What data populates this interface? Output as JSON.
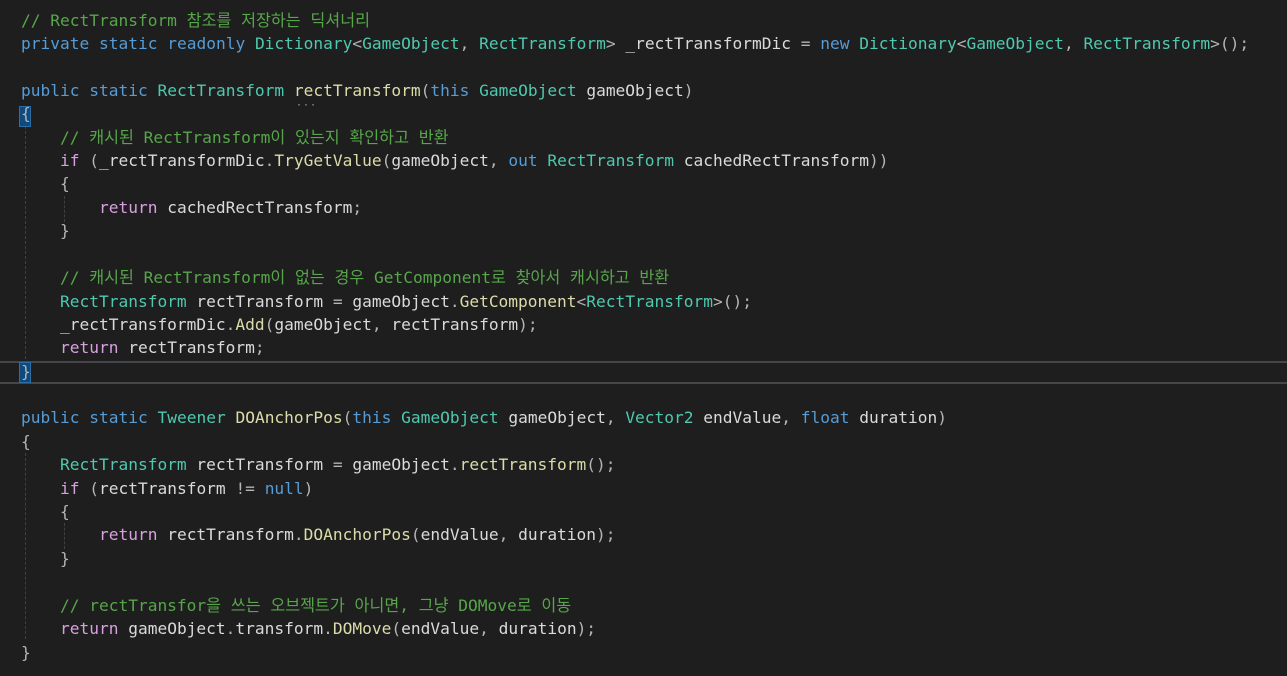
{
  "editor": {
    "lines": [
      [
        [
          "c",
          "// RectTransform 참조를 저장하는 딕셔너리"
        ]
      ],
      [
        [
          "k",
          "private"
        ],
        [
          "v",
          " "
        ],
        [
          "k",
          "static"
        ],
        [
          "v",
          " "
        ],
        [
          "k",
          "readonly"
        ],
        [
          "v",
          " "
        ],
        [
          "ty",
          "Dictionary"
        ],
        [
          "p",
          "<"
        ],
        [
          "ty",
          "GameObject"
        ],
        [
          "p",
          ", "
        ],
        [
          "ty",
          "RectTransform"
        ],
        [
          "p",
          ">"
        ],
        [
          "v",
          " _rectTransformDic "
        ],
        [
          "p",
          "="
        ],
        [
          "v",
          " "
        ],
        [
          "k",
          "new"
        ],
        [
          "v",
          " "
        ],
        [
          "ty",
          "Dictionary"
        ],
        [
          "p",
          "<"
        ],
        [
          "ty",
          "GameObject"
        ],
        [
          "p",
          ", "
        ],
        [
          "ty",
          "RectTransform"
        ],
        [
          "p",
          ">();"
        ]
      ],
      [],
      [
        [
          "k",
          "public"
        ],
        [
          "v",
          " "
        ],
        [
          "k",
          "static"
        ],
        [
          "v",
          " "
        ],
        [
          "ty",
          "RectTransform"
        ],
        [
          "v",
          " "
        ],
        [
          "m",
          "rectTransform"
        ],
        [
          "p",
          "("
        ],
        [
          "k",
          "this"
        ],
        [
          "v",
          " "
        ],
        [
          "ty",
          "GameObject"
        ],
        [
          "v",
          " gameObject"
        ],
        [
          "p",
          ")"
        ]
      ],
      [
        [
          "p",
          "{"
        ]
      ],
      [
        [
          "v",
          "    "
        ],
        [
          "c",
          "// 캐시된 RectTransform이 있는지 확인하고 반환"
        ]
      ],
      [
        [
          "v",
          "    "
        ],
        [
          "kc",
          "if"
        ],
        [
          "v",
          " "
        ],
        [
          "p",
          "("
        ],
        [
          "v",
          "_rectTransformDic"
        ],
        [
          "p",
          "."
        ],
        [
          "m",
          "TryGetValue"
        ],
        [
          "p",
          "("
        ],
        [
          "v",
          "gameObject"
        ],
        [
          "p",
          ", "
        ],
        [
          "k",
          "out"
        ],
        [
          "v",
          " "
        ],
        [
          "ty",
          "RectTransform"
        ],
        [
          "v",
          " cachedRectTransform"
        ],
        [
          "p",
          "))"
        ]
      ],
      [
        [
          "v",
          "    "
        ],
        [
          "p",
          "{"
        ]
      ],
      [
        [
          "v",
          "        "
        ],
        [
          "kc",
          "return"
        ],
        [
          "v",
          " cachedRectTransform"
        ],
        [
          "p",
          ";"
        ]
      ],
      [
        [
          "v",
          "    "
        ],
        [
          "p",
          "}"
        ]
      ],
      [],
      [
        [
          "v",
          "    "
        ],
        [
          "c",
          "// 캐시된 RectTransform이 없는 경우 GetComponent로 찾아서 캐시하고 반환"
        ]
      ],
      [
        [
          "v",
          "    "
        ],
        [
          "ty",
          "RectTransform"
        ],
        [
          "v",
          " rectTransform "
        ],
        [
          "p",
          "="
        ],
        [
          "v",
          " gameObject"
        ],
        [
          "p",
          "."
        ],
        [
          "m",
          "GetComponent"
        ],
        [
          "p",
          "<"
        ],
        [
          "ty",
          "RectTransform"
        ],
        [
          "p",
          ">();"
        ]
      ],
      [
        [
          "v",
          "    _rectTransformDic"
        ],
        [
          "p",
          "."
        ],
        [
          "m",
          "Add"
        ],
        [
          "p",
          "("
        ],
        [
          "v",
          "gameObject"
        ],
        [
          "p",
          ", "
        ],
        [
          "v",
          "rectTransform"
        ],
        [
          "p",
          ");"
        ]
      ],
      [
        [
          "v",
          "    "
        ],
        [
          "kc",
          "return"
        ],
        [
          "v",
          " rectTransform"
        ],
        [
          "p",
          ";"
        ]
      ],
      [
        [
          "p",
          "}"
        ]
      ],
      [],
      [
        [
          "k",
          "public"
        ],
        [
          "v",
          " "
        ],
        [
          "k",
          "static"
        ],
        [
          "v",
          " "
        ],
        [
          "ty",
          "Tweener"
        ],
        [
          "v",
          " "
        ],
        [
          "m",
          "DOAnchorPos"
        ],
        [
          "p",
          "("
        ],
        [
          "k",
          "this"
        ],
        [
          "v",
          " "
        ],
        [
          "ty",
          "GameObject"
        ],
        [
          "v",
          " gameObject"
        ],
        [
          "p",
          ", "
        ],
        [
          "ty",
          "Vector2"
        ],
        [
          "v",
          " endValue"
        ],
        [
          "p",
          ", "
        ],
        [
          "k",
          "float"
        ],
        [
          "v",
          " duration"
        ],
        [
          "p",
          ")"
        ]
      ],
      [
        [
          "p",
          "{"
        ]
      ],
      [
        [
          "v",
          "    "
        ],
        [
          "ty",
          "RectTransform"
        ],
        [
          "v",
          " rectTransform "
        ],
        [
          "p",
          "="
        ],
        [
          "v",
          " gameObject"
        ],
        [
          "p",
          "."
        ],
        [
          "m",
          "rectTransform"
        ],
        [
          "p",
          "();"
        ]
      ],
      [
        [
          "v",
          "    "
        ],
        [
          "kc",
          "if"
        ],
        [
          "v",
          " "
        ],
        [
          "p",
          "("
        ],
        [
          "v",
          "rectTransform "
        ],
        [
          "p",
          "!="
        ],
        [
          "v",
          " "
        ],
        [
          "k",
          "null"
        ],
        [
          "p",
          ")"
        ]
      ],
      [
        [
          "v",
          "    "
        ],
        [
          "p",
          "{"
        ]
      ],
      [
        [
          "v",
          "        "
        ],
        [
          "kc",
          "return"
        ],
        [
          "v",
          " rectTransform"
        ],
        [
          "p",
          "."
        ],
        [
          "m",
          "DOAnchorPos"
        ],
        [
          "p",
          "("
        ],
        [
          "v",
          "endValue"
        ],
        [
          "p",
          ", "
        ],
        [
          "v",
          "duration"
        ],
        [
          "p",
          ");"
        ]
      ],
      [
        [
          "v",
          "    "
        ],
        [
          "p",
          "}"
        ]
      ],
      [],
      [
        [
          "v",
          "    "
        ],
        [
          "c",
          "// rectTransfor을 쓰는 오브젝트가 아니면, 그냥 DOMove로 이동"
        ]
      ],
      [
        [
          "v",
          "    "
        ],
        [
          "kc",
          "return"
        ],
        [
          "v",
          " gameObject"
        ],
        [
          "p",
          "."
        ],
        [
          "v",
          "transform"
        ],
        [
          "p",
          "."
        ],
        [
          "m",
          "DOMove"
        ],
        [
          "p",
          "("
        ],
        [
          "v",
          "endValue"
        ],
        [
          "p",
          ", "
        ],
        [
          "v",
          "duration"
        ],
        [
          "p",
          ");"
        ]
      ],
      [
        [
          "p",
          "}"
        ]
      ]
    ]
  },
  "theme": {
    "background": "#1e1e1e",
    "comment": "#57a64a",
    "keyword": "#569cd6",
    "control_keyword": "#d8a0df",
    "type": "#4ec9b0",
    "method": "#dcdcaa",
    "variable": "#dadada",
    "punctuation": "#b4b4b4",
    "current_line_border": "#46464a",
    "brace_match": "#0e4a7d"
  }
}
